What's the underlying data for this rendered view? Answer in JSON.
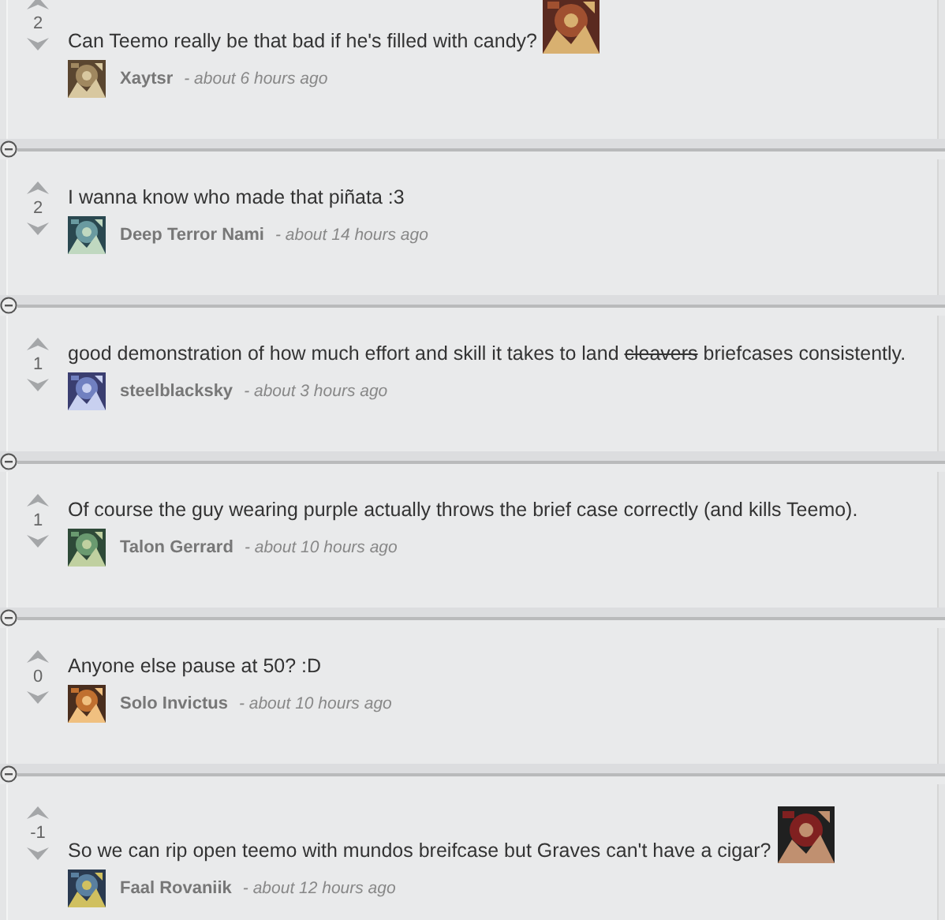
{
  "comments": [
    {
      "score": "2",
      "text": [
        {
          "text": "Can Teemo really be that bad if he's filled with candy?",
          "struck": false
        }
      ],
      "author": "Xaytsr",
      "time": "- about 6 hours ago"
    },
    {
      "score": "2",
      "text": [
        {
          "text": "I wanna know who made that piñata :3",
          "struck": false
        }
      ],
      "author": "Deep Terror Nami",
      "time": "- about 14 hours ago"
    },
    {
      "score": "1",
      "text": [
        {
          "text": "good demonstration of how much effort and skill it takes to land ",
          "struck": false
        },
        {
          "text": "cleavers",
          "struck": true
        },
        {
          "text": " briefcases consistently.",
          "struck": false
        }
      ],
      "author": "steelblacksky",
      "time": "- about 3 hours ago"
    },
    {
      "score": "1",
      "text": [
        {
          "text": "Of course the guy wearing purple actually throws the brief case correctly (and kills Teemo).",
          "struck": false
        }
      ],
      "author": "Talon Gerrard",
      "time": "- about 10 hours ago"
    },
    {
      "score": "0",
      "text": [
        {
          "text": "Anyone else pause at 50? :D",
          "struck": false
        }
      ],
      "author": "Solo Invictus",
      "time": "- about 10 hours ago"
    },
    {
      "score": "-1",
      "text": [
        {
          "text": "So we can rip open teemo with mundos breifcase but Graves can't have a cigar?",
          "struck": false
        }
      ],
      "author": "Faal Rovaniik",
      "time": "- about 12 hours ago"
    }
  ]
}
